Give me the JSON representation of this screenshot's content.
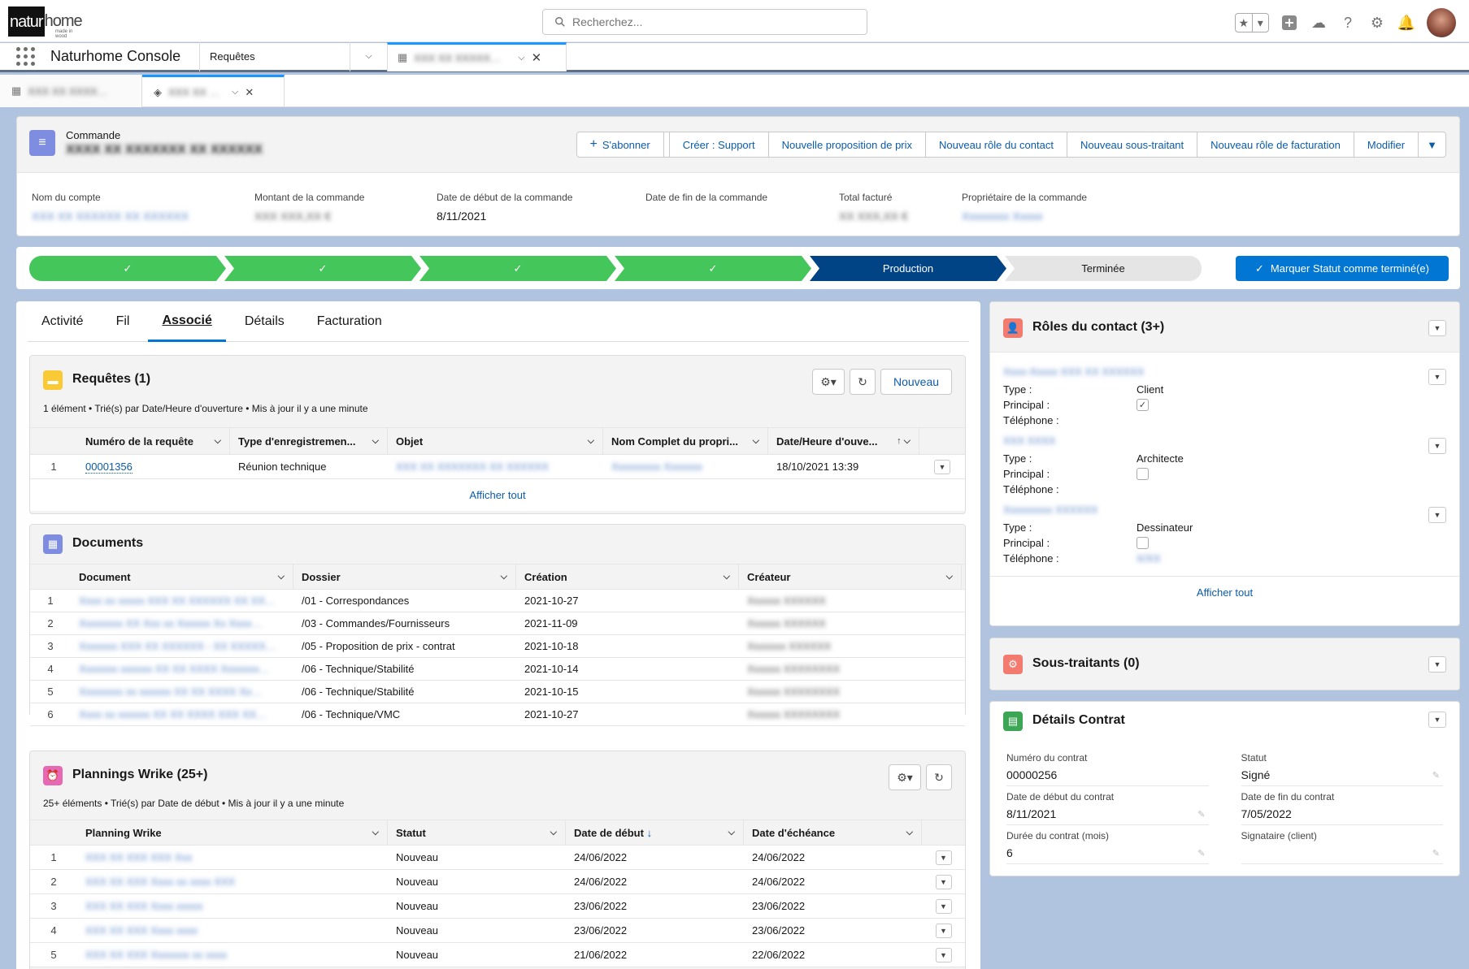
{
  "header": {
    "logo_text_1": "natur",
    "logo_text_2": "home",
    "logo_sub": "made in wood",
    "search_placeholder": "Recherchez..."
  },
  "nav": {
    "app_name": "Naturhome Console",
    "tab_requetes": "Requêtes",
    "active_tab_label": "XXX XX XXXXX…"
  },
  "subtabs": {
    "tab1_label": "XXX XX XXXX…",
    "tab2_label": "XXX XX …"
  },
  "record": {
    "object_label": "Commande",
    "name": "XXXX XX XXXXXXX XX XXXXXX",
    "actions": {
      "subscribe": "S'abonner",
      "create_support": "Créer : Support",
      "new_quote": "Nouvelle proposition de prix",
      "new_contact_role": "Nouveau rôle du contact",
      "new_subcontractor": "Nouveau sous-traitant",
      "new_billing_role": "Nouveau rôle de facturation",
      "edit": "Modifier"
    },
    "fields": {
      "account_label": "Nom du compte",
      "account_value": "XXX XX XXXXXX XX XXXXXX",
      "amount_label": "Montant de la commande",
      "amount_value": "XXX XXX,XX €",
      "start_label": "Date de début de la commande",
      "start_value": "8/11/2021",
      "end_label": "Date de fin de la commande",
      "end_value": "",
      "billed_label": "Total facturé",
      "billed_value": "XX XXX,XX €",
      "owner_label": "Propriétaire de la commande",
      "owner_value": "Xxxxxxxx Xxxxx"
    }
  },
  "path": {
    "steps": [
      "✓",
      "✓",
      "✓",
      "✓"
    ],
    "current": "Production",
    "next": "Terminée",
    "mark_button": "Marquer Statut comme terminé(e)"
  },
  "tabs": [
    "Activité",
    "Fil",
    "Associé",
    "Détails",
    "Facturation"
  ],
  "requetes": {
    "title": "Requêtes (1)",
    "meta": "1 élément • Trié(s) par Date/Heure d'ouverture • Mis à jour il y a une minute",
    "new_button": "Nouveau",
    "columns": [
      "Numéro de la requête",
      "Type d'enregistremen...",
      "Objet",
      "Nom Complet du propri...",
      "Date/Heure d'ouve..."
    ],
    "rows": [
      {
        "num": "1",
        "numero": "00001356",
        "type": "Réunion technique",
        "objet": "XXX XX XXXXXXX XX XXXXXX",
        "proprio": "Xxxxxxxxx Xxxxxxx",
        "date": "18/10/2021 13:39"
      }
    ],
    "show_all": "Afficher tout"
  },
  "documents": {
    "title": "Documents",
    "columns": [
      "Document",
      "Dossier",
      "Création",
      "Créateur"
    ],
    "rows": [
      {
        "num": "1",
        "doc": "Xxxx xx xxxxx XXX XX XXXXXX XX XX…",
        "dossier": "/01 - Correspondances",
        "creation": "2021-10-27",
        "createur": "Xxxxxx XXXXXX"
      },
      {
        "num": "2",
        "doc": "Xxxxxxxx XX Xxx xx Xxxxxx Xx Xxxx…",
        "dossier": "/03 - Commandes/Fournisseurs",
        "creation": "2021-11-09",
        "createur": "Xxxxxx XXXXXX"
      },
      {
        "num": "3",
        "doc": "Xxxxxxx XXX XX XXXXXX - XX XXXXX…",
        "dossier": "/05 - Proposition de prix - contrat",
        "creation": "2021-10-18",
        "createur": "Xxxxxxx XXXXXX"
      },
      {
        "num": "4",
        "doc": "Xxxxxxx xxxxxx XX XX XXXX Xxxxxxx…",
        "dossier": "/06 - Technique/Stabilité",
        "creation": "2021-10-14",
        "createur": "Xxxxxx XXXXXXXX"
      },
      {
        "num": "5",
        "doc": "Xxxxxxxx xx xxxxxx XX XX XXXX Xx…",
        "dossier": "/06 - Technique/Stabilité",
        "creation": "2021-10-15",
        "createur": "Xxxxxx XXXXXXXX"
      },
      {
        "num": "6",
        "doc": "Xxxx xx xxxxxx XX XX XXXX XXX XX…",
        "dossier": "/06 - Technique/VMC",
        "creation": "2021-10-27",
        "createur": "Xxxxxx XXXXXXXX"
      }
    ]
  },
  "plannings": {
    "title": "Plannings Wrike (25+)",
    "meta": "25+ éléments • Trié(s) par Date de début • Mis à jour il y a une minute",
    "columns": [
      "Planning Wrike",
      "Statut",
      "Date de début",
      "Date d'échéance"
    ],
    "rows": [
      {
        "num": "1",
        "name": "XXX XX XXX XXX Xxx",
        "statut": "Nouveau",
        "debut": "24/06/2022",
        "echeance": "24/06/2022"
      },
      {
        "num": "2",
        "name": "XXX XX XXX Xxxx xx xxxx XXX",
        "statut": "Nouveau",
        "debut": "24/06/2022",
        "echeance": "24/06/2022"
      },
      {
        "num": "3",
        "name": "XXX XX XXX Xxxx xxxxx",
        "statut": "Nouveau",
        "debut": "23/06/2022",
        "echeance": "23/06/2022"
      },
      {
        "num": "4",
        "name": "XXX XX XXX Xxxx xxxx",
        "statut": "Nouveau",
        "debut": "23/06/2022",
        "echeance": "23/06/2022"
      },
      {
        "num": "5",
        "name": "XXX XX XXX Xxxxxxx xx xxxx",
        "statut": "Nouveau",
        "debut": "21/06/2022",
        "echeance": "22/06/2022"
      }
    ]
  },
  "roles": {
    "title": "Rôles du contact (3+)",
    "type_label": "Type :",
    "principal_label": "Principal :",
    "phone_label": "Téléphone :",
    "items": [
      {
        "name": "Xxxx-Xxxxx XXX XX XXXXXX",
        "type": "Client",
        "principal": "✓",
        "phone": ""
      },
      {
        "name": "XXX XXXX",
        "type": "Architecte",
        "principal": "",
        "phone": ""
      },
      {
        "name": "Xxxxxxxxx XXXXXX",
        "type": "Dessinateur",
        "principal": "",
        "phone": "X/XX"
      }
    ],
    "show_all": "Afficher tout"
  },
  "subcontractors": {
    "title": "Sous-traitants (0)"
  },
  "contract": {
    "title": "Détails Contrat",
    "fields": {
      "num_label": "Numéro du contrat",
      "num_value": "00000256",
      "status_label": "Statut",
      "status_value": "Signé",
      "start_label": "Date de début du contrat",
      "start_value": "8/11/2021",
      "end_label": "Date de fin du contrat",
      "end_value": "7/05/2022",
      "duration_label": "Durée du contrat (mois)",
      "duration_value": "6",
      "signer_label": "Signataire (client)",
      "signer_value": ""
    }
  }
}
